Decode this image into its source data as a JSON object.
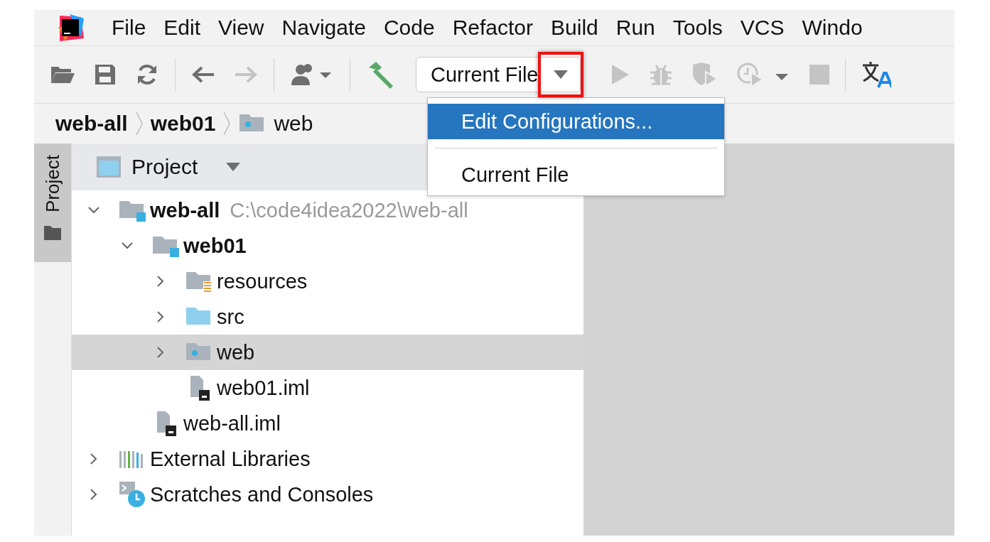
{
  "menu": [
    {
      "label": "File"
    },
    {
      "label": "Edit"
    },
    {
      "label": "View"
    },
    {
      "label": "Navigate"
    },
    {
      "label": "Code"
    },
    {
      "label": "Refactor"
    },
    {
      "label": "Build"
    },
    {
      "label": "Run"
    },
    {
      "label": "Tools"
    },
    {
      "label": "VCS"
    },
    {
      "label": "Windo"
    }
  ],
  "run_config": {
    "value": "Current File",
    "highlighted": true
  },
  "run_config_menu": [
    {
      "label": "Edit Configurations...",
      "selected": true
    },
    {
      "label": "Current File",
      "selected": false
    }
  ],
  "breadcrumbs": [
    {
      "label": "web-all",
      "kind": "module"
    },
    {
      "label": "web01",
      "kind": "module"
    },
    {
      "label": "web",
      "kind": "web-folder"
    }
  ],
  "tool_window_stripe": [
    {
      "label": "Project",
      "selected": true
    }
  ],
  "project_panel": {
    "title": "Project",
    "tree": [
      {
        "label": "web-all",
        "kind": "module",
        "hint": "C:\\code4idea2022\\web-all",
        "expanded": true,
        "selected": false,
        "children": [
          {
            "label": "web01",
            "kind": "module",
            "expanded": true,
            "selected": false,
            "children": [
              {
                "label": "resources",
                "kind": "resources-folder",
                "expanded": false,
                "selected": false
              },
              {
                "label": "src",
                "kind": "source-folder",
                "expanded": false,
                "selected": false
              },
              {
                "label": "web",
                "kind": "web-folder",
                "expanded": false,
                "selected": true
              },
              {
                "label": "web01.iml",
                "kind": "iml-file",
                "selected": false
              }
            ]
          },
          {
            "label": "web-all.iml",
            "kind": "iml-file",
            "selected": false
          }
        ]
      },
      {
        "label": "External Libraries",
        "kind": "libraries",
        "expanded": false,
        "selected": false
      },
      {
        "label": "Scratches and Consoles",
        "kind": "scratches",
        "expanded": false,
        "selected": false
      }
    ]
  }
}
